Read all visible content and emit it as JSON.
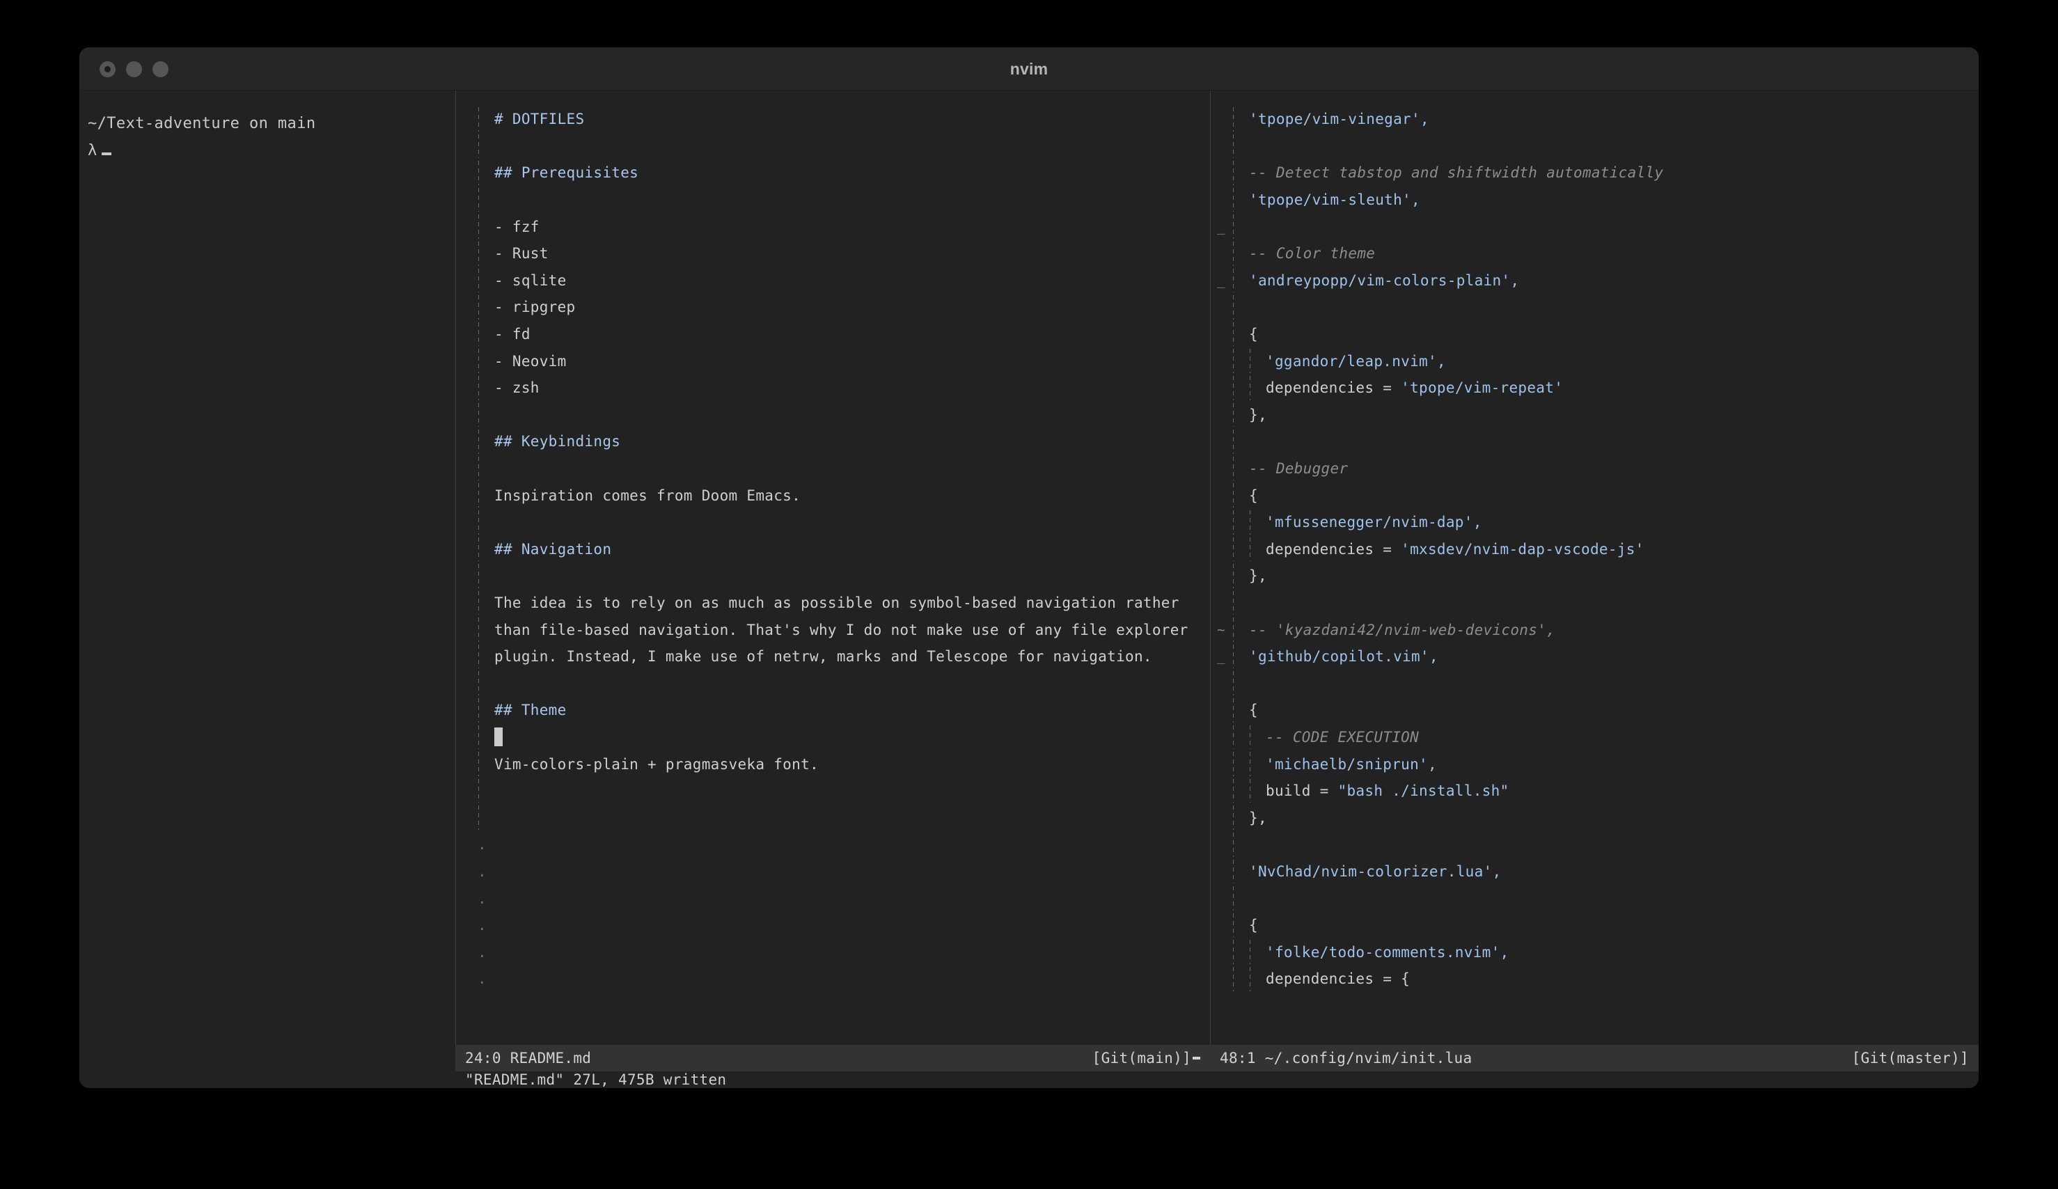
{
  "window": {
    "title": "nvim",
    "traffic_lights": [
      "close",
      "minimize",
      "maximize"
    ]
  },
  "shell_pane": {
    "prompt_path": "~/Text-adventure on main",
    "prompt_symbol": "λ"
  },
  "readme_pane": {
    "filename": "README.md",
    "lines": [
      {
        "indent": 1,
        "text": "# DOTFILES",
        "kind": "head"
      },
      {
        "indent": 1,
        "text": "",
        "kind": "plain"
      },
      {
        "indent": 1,
        "text": "## Prerequisites",
        "kind": "head"
      },
      {
        "indent": 1,
        "text": "",
        "kind": "plain"
      },
      {
        "indent": 1,
        "text": "- fzf",
        "kind": "plain"
      },
      {
        "indent": 1,
        "text": "- Rust",
        "kind": "plain"
      },
      {
        "indent": 1,
        "text": "- sqlite",
        "kind": "plain"
      },
      {
        "indent": 1,
        "text": "- ripgrep",
        "kind": "plain"
      },
      {
        "indent": 1,
        "text": "- fd",
        "kind": "plain"
      },
      {
        "indent": 1,
        "text": "- Neovim",
        "kind": "plain"
      },
      {
        "indent": 1,
        "text": "- zsh",
        "kind": "plain"
      },
      {
        "indent": 1,
        "text": "",
        "kind": "plain"
      },
      {
        "indent": 1,
        "text": "## Keybindings",
        "kind": "head"
      },
      {
        "indent": 1,
        "text": "",
        "kind": "plain"
      },
      {
        "indent": 1,
        "text": "Inspiration comes from Doom Emacs.",
        "kind": "plain"
      },
      {
        "indent": 1,
        "text": "",
        "kind": "plain"
      },
      {
        "indent": 1,
        "text": "## Navigation",
        "kind": "head"
      },
      {
        "indent": 1,
        "text": "",
        "kind": "plain"
      },
      {
        "indent": 1,
        "text": "The idea is to rely on as much as possible on symbol-based navigation rather",
        "kind": "plain"
      },
      {
        "indent": 1,
        "text": "than file-based navigation. That's why I do not make use of any file explorer",
        "kind": "plain"
      },
      {
        "indent": 1,
        "text": "plugin. Instead, I make use of netrw, marks and Telescope for navigation.",
        "kind": "plain"
      },
      {
        "indent": 1,
        "text": "",
        "kind": "plain"
      },
      {
        "indent": 1,
        "text": "## Theme",
        "kind": "head"
      },
      {
        "indent": 1,
        "text": "",
        "kind": "cursor"
      },
      {
        "indent": 1,
        "text": "Vim-colors-plain + pragmasveka font.",
        "kind": "plain"
      },
      {
        "indent": 1,
        "text": "",
        "kind": "plain"
      },
      {
        "indent": 1,
        "text": "",
        "kind": "plain"
      },
      {
        "indent": 0,
        "text": "",
        "kind": "eob"
      },
      {
        "indent": 0,
        "text": "",
        "kind": "eob"
      },
      {
        "indent": 0,
        "text": "",
        "kind": "eob"
      },
      {
        "indent": 0,
        "text": "",
        "kind": "eob"
      },
      {
        "indent": 0,
        "text": "",
        "kind": "eob"
      },
      {
        "indent": 0,
        "text": "",
        "kind": "eob"
      }
    ],
    "status": {
      "position": "24:0",
      "filename": "README.md",
      "git_branch": "[Git(main)]"
    }
  },
  "init_pane": {
    "filename": "~/.config/nvim/init.lua",
    "lines": [
      {
        "gutter": "",
        "indent": 1,
        "text": "'tpope/vim-vinegar',",
        "kind": "str"
      },
      {
        "gutter": "",
        "indent": 1,
        "text": "",
        "kind": "plain"
      },
      {
        "gutter": "",
        "indent": 1,
        "text": "-- Detect tabstop and shiftwidth automatically",
        "kind": "comment"
      },
      {
        "gutter": "",
        "indent": 1,
        "text": "'tpope/vim-sleuth',",
        "kind": "str"
      },
      {
        "gutter": "_",
        "indent": 1,
        "text": "",
        "kind": "plain"
      },
      {
        "gutter": "",
        "indent": 1,
        "text": "-- Color theme",
        "kind": "comment"
      },
      {
        "gutter": "_",
        "indent": 1,
        "text": "'andreypopp/vim-colors-plain',",
        "kind": "str"
      },
      {
        "gutter": "",
        "indent": 1,
        "text": "",
        "kind": "plain"
      },
      {
        "gutter": "",
        "indent": 1,
        "text": "{",
        "kind": "plain"
      },
      {
        "gutter": "",
        "indent": 2,
        "text": "'ggandor/leap.nvim',",
        "kind": "str"
      },
      {
        "gutter": "",
        "indent": 2,
        "text": "dependencies = 'tpope/vim-repeat'",
        "kind": "mixed-dep-repeat"
      },
      {
        "gutter": "",
        "indent": 1,
        "text": "},",
        "kind": "plain"
      },
      {
        "gutter": "",
        "indent": 1,
        "text": "",
        "kind": "plain"
      },
      {
        "gutter": "",
        "indent": 1,
        "text": "-- Debugger",
        "kind": "comment"
      },
      {
        "gutter": "",
        "indent": 1,
        "text": "{",
        "kind": "plain"
      },
      {
        "gutter": "",
        "indent": 2,
        "text": "'mfussenegger/nvim-dap',",
        "kind": "str"
      },
      {
        "gutter": "",
        "indent": 2,
        "text": "dependencies = 'mxsdev/nvim-dap-vscode-js'",
        "kind": "mixed-dep-dap"
      },
      {
        "gutter": "",
        "indent": 1,
        "text": "},",
        "kind": "plain"
      },
      {
        "gutter": "",
        "indent": 1,
        "text": "",
        "kind": "plain"
      },
      {
        "gutter": "~",
        "indent": 1,
        "text": "-- 'kyazdani42/nvim-web-devicons',",
        "kind": "comment"
      },
      {
        "gutter": "_",
        "indent": 1,
        "text": "'github/copilot.vim',",
        "kind": "str"
      },
      {
        "gutter": "",
        "indent": 1,
        "text": "",
        "kind": "plain"
      },
      {
        "gutter": "",
        "indent": 1,
        "text": "{",
        "kind": "plain"
      },
      {
        "gutter": "",
        "indent": 2,
        "text": "-- CODE EXECUTION",
        "kind": "comment"
      },
      {
        "gutter": "",
        "indent": 2,
        "text": "'michaelb/sniprun',",
        "kind": "str"
      },
      {
        "gutter": "",
        "indent": 2,
        "text": "build = \"bash ./install.sh\"",
        "kind": "mixed-build"
      },
      {
        "gutter": "",
        "indent": 1,
        "text": "},",
        "kind": "plain"
      },
      {
        "gutter": "",
        "indent": 1,
        "text": "",
        "kind": "plain"
      },
      {
        "gutter": "",
        "indent": 1,
        "text": "'NvChad/nvim-colorizer.lua',",
        "kind": "str"
      },
      {
        "gutter": "",
        "indent": 1,
        "text": "",
        "kind": "plain"
      },
      {
        "gutter": "",
        "indent": 1,
        "text": "{",
        "kind": "plain"
      },
      {
        "gutter": "",
        "indent": 2,
        "text": "'folke/todo-comments.nvim',",
        "kind": "str"
      },
      {
        "gutter": "",
        "indent": 2,
        "text": "dependencies = {",
        "kind": "plain"
      }
    ],
    "status": {
      "position": "48:1",
      "filename": "~/.config/nvim/init.lua",
      "git_branch": "[Git(master)]"
    }
  },
  "message_line": {
    "text": "\"README.md\" 27L, 475B written"
  },
  "colors": {
    "terminal_bg": "#222222",
    "titlebar_bg": "#262626",
    "statusline_bg": "#333333",
    "text": "#cfcfcf",
    "heading": "#a9c7ea",
    "string": "#9ec2ea",
    "comment": "#8d8d8d",
    "guide": "#6a6a6a",
    "divider": "#3d3d3d"
  }
}
